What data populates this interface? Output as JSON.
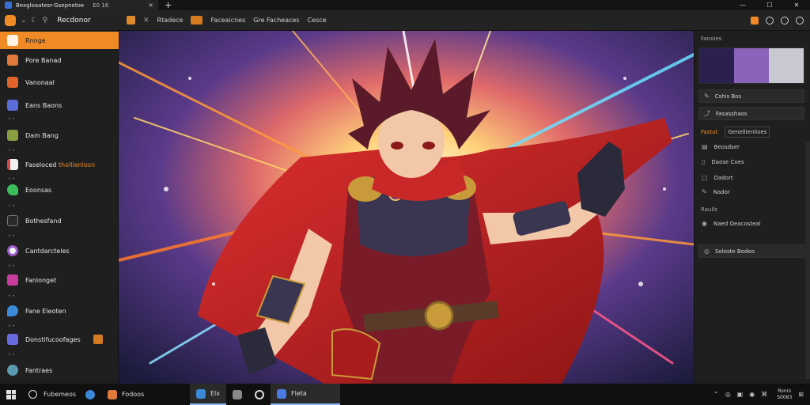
{
  "titlebar": {
    "tab_title": "Bexgloaatesr-Gsepnetoe",
    "tab_count": "E0 16",
    "close_glyph": "×",
    "new_tab_glyph": "+",
    "window_controls": {
      "minimize": "—",
      "maximize": "☐",
      "close": "✕"
    }
  },
  "toolbar": {
    "app_name": "Recdonor",
    "menus": [
      "Rtadece",
      "Faceaicnes",
      "Gre Facheaces",
      "Cesce"
    ],
    "active_menu_index": 1
  },
  "sidebar": {
    "items": [
      {
        "label": "Rnnge",
        "icon": "layers-icon",
        "color": "#f08a24",
        "active": true
      },
      {
        "label": "Pore Banad",
        "icon": "fox-icon",
        "color": "#e07a3a"
      },
      {
        "label": "Vanonaal",
        "icon": "fox-face-icon",
        "color": "#e0642c"
      },
      {
        "label": "Eans Baons",
        "icon": "stack-icon",
        "color": "#5a6cd8"
      },
      {
        "label": "Dam Bang",
        "icon": "landscape-icon",
        "color": "#8aa040"
      },
      {
        "label": "Faseloced",
        "label_accent": "thollienlosn",
        "icon": "document-icon",
        "color": "#d84a4a"
      },
      {
        "label": "Eoonsas",
        "icon": "leaf-icon",
        "color": "#3cbd5a"
      },
      {
        "label": "Bothesfand",
        "icon": "grid-icon",
        "color": "#b84ae0"
      },
      {
        "label": "Cantdarcteles",
        "icon": "circle-icon",
        "color": "#9a5ac8"
      },
      {
        "label": "Fanlonget",
        "icon": "magenta-square-icon",
        "color": "#c83ca0"
      },
      {
        "label": "Fane Eleoten",
        "icon": "water-drop-icon",
        "color": "#3a8ad8"
      },
      {
        "label": "Donstifucoofages",
        "icon": "frame-icon",
        "color": "#6a6ae0",
        "tag": true
      },
      {
        "label": "Fantraes",
        "icon": "globe-icon",
        "color": "#5a9ab0"
      }
    ]
  },
  "right_panel": {
    "section_title": "Fanoies",
    "thumbnails": [
      "#2b2050",
      "#8a64b8",
      "#c8c8d0"
    ],
    "action_1": "Cshis Bos",
    "action_2": "Fasasshaos",
    "tabs": [
      "Fastut",
      "Genellienlioes"
    ],
    "rows": [
      "Beosdser",
      "Daose Coes",
      "Dadort",
      "Nador"
    ],
    "section_2": "Raulls",
    "section_2_item": "Naed Oeacosteal",
    "action_3": "Soloste Bodeo"
  },
  "taskbar": {
    "search_label": "Fubemeos",
    "apps": [
      {
        "label": "",
        "icon": "browser-icon",
        "color": "#3a8ad8"
      },
      {
        "label": "Fodoos",
        "icon": "fox-app-icon",
        "color": "#e07a3a"
      },
      {
        "label": "Elx",
        "icon": "photo-icon",
        "color": "#3a8ad8",
        "active": true
      },
      {
        "label": "",
        "icon": "gallery-icon",
        "color": "#888888"
      },
      {
        "label": "",
        "icon": "settings-icon",
        "color": "#dddddd"
      },
      {
        "label": "Fleta",
        "icon": "app-icon",
        "color": "#4a7ae0",
        "active": true
      }
    ],
    "tray": [
      "⌃",
      "◎",
      "▣",
      "◉",
      "⌘",
      "⊞"
    ],
    "clock_time": "Ronrs",
    "clock_date": "S0083"
  },
  "colors": {
    "accent": "#f08a24",
    "panel": "#1f1f1f",
    "bar": "#232323"
  }
}
